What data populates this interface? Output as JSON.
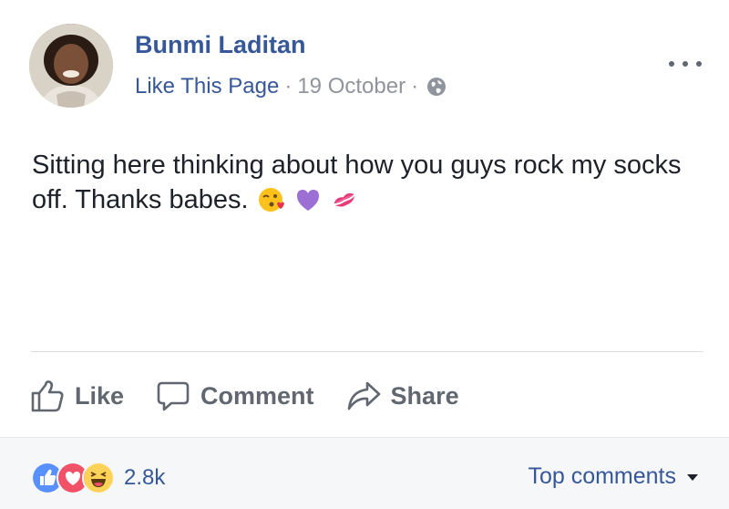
{
  "post": {
    "author": "Bunmi Laditan",
    "like_page": "Like This Page",
    "separator": "·",
    "date": "19 October",
    "text": "Sitting here thinking about how you guys rock my socks off. Thanks babes.",
    "emojis": [
      "kissing-heart-emoji",
      "purple-heart-emoji",
      "kiss-mark-emoji"
    ]
  },
  "actions": {
    "like": "Like",
    "comment": "Comment",
    "share": "Share"
  },
  "footer": {
    "reactions": [
      "like-reaction-icon",
      "love-reaction-icon",
      "haha-reaction-icon"
    ],
    "count": "2.8k",
    "sort": "Top comments"
  },
  "colors": {
    "link": "#365899",
    "meta": "#90949c",
    "action": "#606770",
    "like_blue": "#5890ff",
    "love_red": "#f25268",
    "haha_yellow": "#fcd258"
  }
}
